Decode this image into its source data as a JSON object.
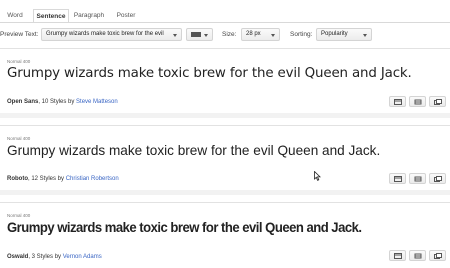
{
  "tabs": [
    {
      "label": "Word"
    },
    {
      "label": "Sentence"
    },
    {
      "label": "Paragraph"
    },
    {
      "label": "Poster"
    }
  ],
  "toolbar": {
    "preview_label": "Preview Text:",
    "preview_value": "Grumpy wizards make toxic brew for the evil",
    "size_label": "Size:",
    "size_value": "28 px",
    "sorting_label": "Sorting:",
    "sorting_value": "Popularity"
  },
  "fonts": [
    {
      "meta": "Normal 400",
      "sample": "Grumpy wizards make toxic brew for the evil Queen and Jack.",
      "family": "Open Sans",
      "styles": ", 10 Styles by ",
      "designer": "Steve Matteson"
    },
    {
      "meta": "Normal 400",
      "sample": "Grumpy wizards make toxic brew for the evil Queen and Jack.",
      "family": "Roboto",
      "styles": ", 12 Styles by ",
      "designer": "Christian Robertson"
    },
    {
      "meta": "Normal 400",
      "sample": "Grumpy wizards make toxic brew for the evil Queen and Jack.",
      "family": "Oswald",
      "styles": ", 3 Styles by ",
      "designer": "Vernon Adams"
    }
  ],
  "icons": [
    "quick-use-icon",
    "pop-out-icon",
    "add-to-collection-icon"
  ]
}
